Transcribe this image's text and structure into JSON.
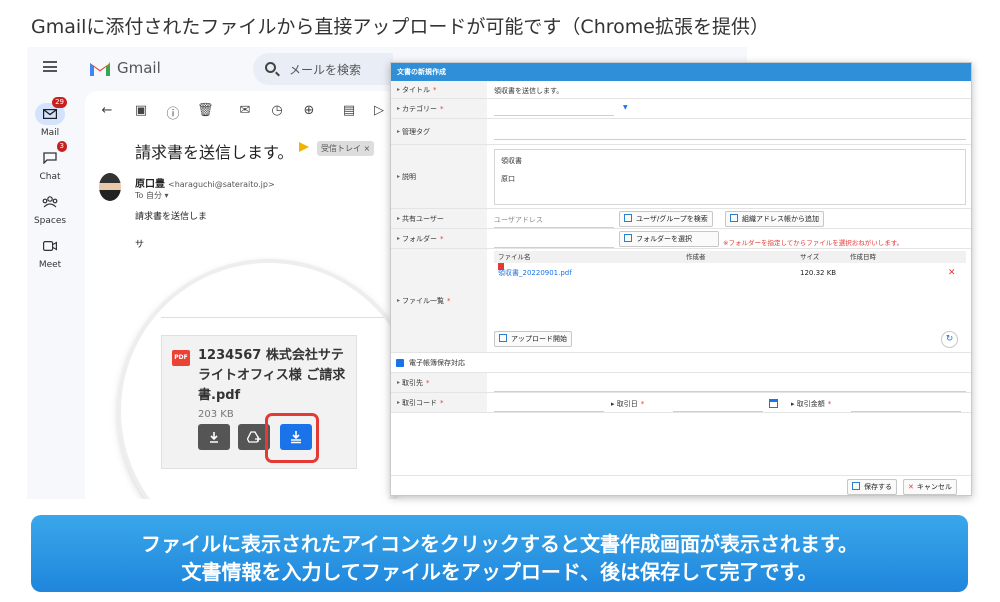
{
  "heading": "Gmailに添付されたファイルから直接アップロードが可能です（Chrome拡張を提供）",
  "gmail": {
    "logo_text": "Gmail",
    "search_placeholder": "メールを検索",
    "rail": [
      {
        "label": "Mail",
        "badge": "29",
        "icon": "mail-icon"
      },
      {
        "label": "Chat",
        "badge": "3",
        "icon": "chat-icon"
      },
      {
        "label": "Spaces",
        "badge": "",
        "icon": "spaces-icon"
      },
      {
        "label": "Meet",
        "badge": "",
        "icon": "meet-icon"
      }
    ],
    "subject": "請求書を送信します。",
    "inbox_label": "受信トレイ ×",
    "sender_name": "原口豊",
    "sender_email": "<haraguchi@sateraito.jp>",
    "to": "To 自分 ▾",
    "body_line": "請求書を送信しま",
    "body_line2": "サ",
    "attachment": {
      "badge": "PDF",
      "name": "1234567 株式会社サテライトオフィス様 ご請求書.pdf",
      "size": "203 KB"
    },
    "colors": {
      "accent": "#1a73e8",
      "highlight_ring": "#e53935"
    }
  },
  "dialog": {
    "title": "文書の新規作成",
    "fields": {
      "title_label": "タイトル",
      "title_value": "領収書を送信します。",
      "category_label": "カテゴリー",
      "tags_label": "管理タグ",
      "description_label": "説明",
      "description_line1": "領収書",
      "description_line2": "原口",
      "shared_users_label": "共有ユーザー",
      "user_address_placeholder": "ユーザアドレス",
      "user_group_search": "ユーザ/グループを検索",
      "org_address_add": "組織アドレス帳から追加",
      "folder_label": "フォルダー",
      "folder_select": "フォルダーを選択",
      "folder_hint": "※フォルダーを指定してからファイルを選択おねがいします。",
      "file_list_label": "ファイル一覧",
      "upload_start": "アップロード開始",
      "e_book_label": "電子帳簿保存対応",
      "partner_label": "取引先",
      "trade_code_label": "取引コード",
      "trade_date_label": "取引日",
      "trade_amount_label": "取引金額",
      "required_mark": "*"
    },
    "file_table": {
      "headers": [
        "ファイル名",
        "作成者",
        "サイズ",
        "作成日時"
      ],
      "rows": [
        {
          "name": "領収書_20220901.pdf",
          "creator": "",
          "size": "120.32 KB",
          "created": ""
        }
      ]
    },
    "save_button": "保存する",
    "cancel_button": "キャンセル"
  },
  "banner": {
    "line1": "ファイルに表示されたアイコンをクリックすると文書作成画面が表示されます。",
    "line2": "文書情報を入力してファイルをアップロード、後は保存して完了です。"
  }
}
